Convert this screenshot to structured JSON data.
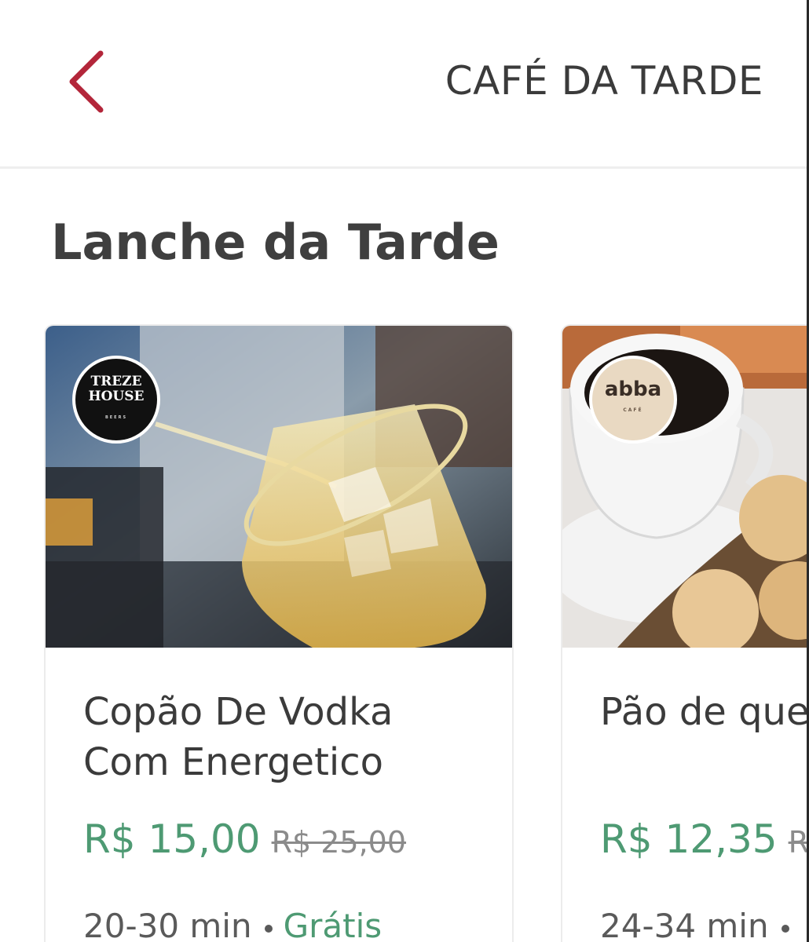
{
  "header": {
    "title": "CAFÉ DA TARDE",
    "back_icon": "chevron-left-icon",
    "accent_color": "#b3263a"
  },
  "section": {
    "title": "Lanche da Tarde"
  },
  "cards": [
    {
      "store_logo_line1": "TREZE",
      "store_logo_line2": "HOUSE",
      "store_logo_sub": "BEERS",
      "name": "Copão De Vodka\nCom Energetico",
      "price": "R$ 15,00",
      "old_price": "R$ 25,00",
      "delivery_time": "20-30 min",
      "delivery_fee": "Grátis"
    },
    {
      "store_logo_line1": "abba",
      "store_logo_sub": "CAFÉ",
      "name": "Pão de queijo",
      "price": "R$ 12,35",
      "old_price": "R$",
      "delivery_time": "24-34 min",
      "delivery_fee": ""
    }
  ],
  "colors": {
    "price_green": "#4e9a73",
    "text_dark": "#3b3b3b"
  }
}
